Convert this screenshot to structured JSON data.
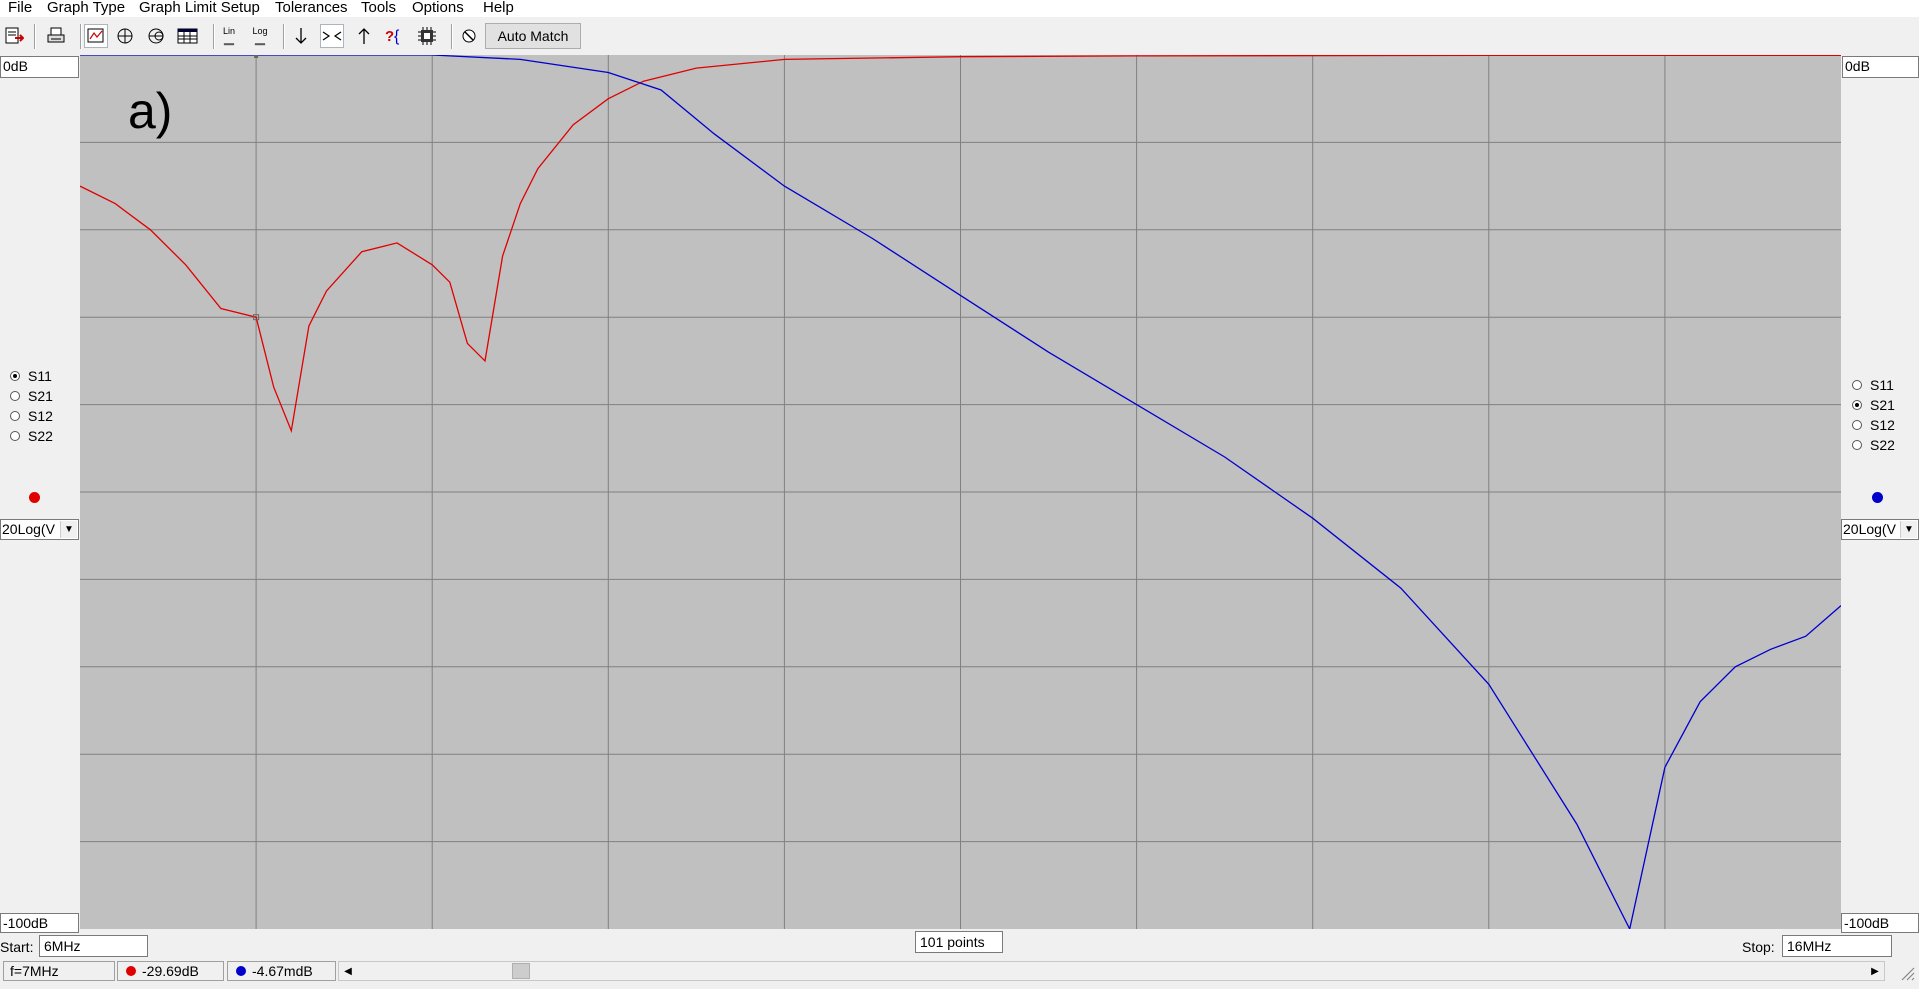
{
  "menu": [
    "File",
    "Graph Type",
    "Graph Limit Setup",
    "Tolerances",
    "Tools",
    "Options",
    "Help"
  ],
  "toolbar": {
    "lin_label": "Lin",
    "log_label": "Log",
    "auto_match_label": "Auto Match"
  },
  "plot": {
    "annotation": "a)",
    "left_top": "0dB",
    "left_bottom": "-100dB",
    "right_top": "0dB",
    "right_bottom": "-100dB"
  },
  "left_panel": {
    "params": [
      "S11",
      "S21",
      "S12",
      "S22"
    ],
    "selected": "S11",
    "trace_color": "#e00000",
    "format": "20Log(V"
  },
  "right_panel": {
    "params": [
      "S11",
      "S21",
      "S12",
      "S22"
    ],
    "selected": "S21",
    "trace_color": "#0000cc",
    "format": "20Log(V"
  },
  "sweep": {
    "start_label": "Start:",
    "start_value": "6MHz",
    "points": "101 points",
    "stop_label": "Stop:",
    "stop_value": "16MHz"
  },
  "status": {
    "freq": "f=7MHz",
    "s11_value": "-29.69dB",
    "s21_value": "-4.67mdB"
  },
  "chart_data": {
    "type": "line",
    "x_unit": "MHz",
    "xlim": [
      6,
      16
    ],
    "ylim": [
      -100,
      0
    ],
    "y_unit": "dB",
    "grid": true,
    "cursor_x": 7,
    "series": [
      {
        "name": "S11",
        "color": "#e00000",
        "x": [
          6.0,
          6.2,
          6.4,
          6.6,
          6.8,
          7.0,
          7.1,
          7.2,
          7.3,
          7.4,
          7.6,
          7.8,
          8.0,
          8.1,
          8.2,
          8.3,
          8.4,
          8.5,
          8.6,
          8.8,
          9.0,
          9.2,
          9.5,
          10.0,
          11.0,
          12.0,
          14.0,
          16.0
        ],
        "y": [
          -15,
          -17,
          -20,
          -24,
          -29,
          -30,
          -38,
          -43,
          -31,
          -27,
          -22.5,
          -21.5,
          -24,
          -26,
          -33,
          -35,
          -23,
          -17,
          -13,
          -8,
          -5,
          -3,
          -1.5,
          -0.5,
          -0.2,
          -0.1,
          -0.05,
          -0.05
        ]
      },
      {
        "name": "S21",
        "color": "#0000cc",
        "x": [
          6.0,
          7.0,
          8.0,
          8.5,
          9.0,
          9.3,
          9.6,
          10.0,
          10.5,
          11.0,
          11.5,
          12.0,
          12.5,
          13.0,
          13.5,
          14.0,
          14.5,
          14.8,
          15.0,
          15.2,
          15.4,
          15.6,
          15.8,
          16.0
        ],
        "y": [
          0,
          0,
          0,
          -0.5,
          -2,
          -4,
          -9,
          -15,
          -21,
          -27.5,
          -34,
          -40,
          -46,
          -53,
          -61,
          -72,
          -88,
          -100,
          -81.5,
          -74,
          -70,
          -68,
          -66.5,
          -63
        ]
      }
    ]
  }
}
